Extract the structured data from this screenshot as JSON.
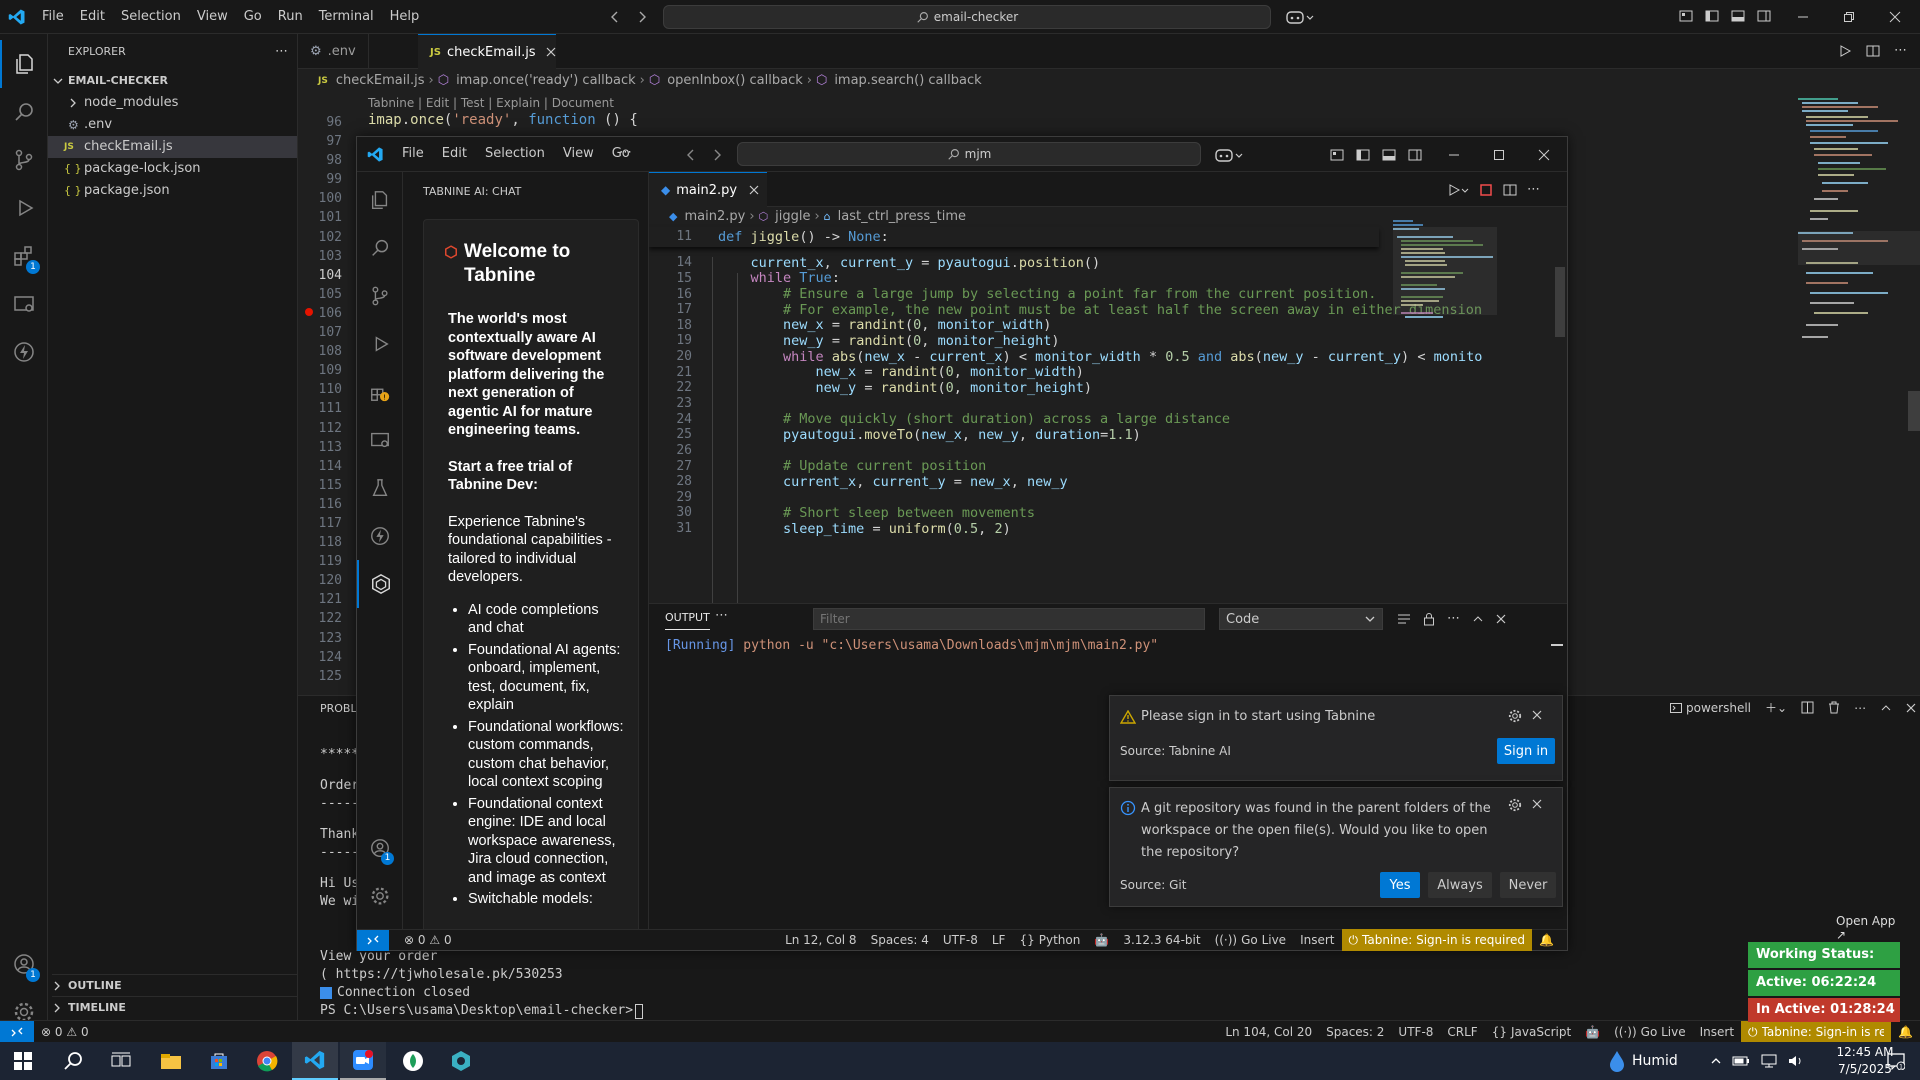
{
  "outer": {
    "menu": [
      "File",
      "Edit",
      "Selection",
      "View",
      "Go",
      "Run",
      "Terminal",
      "Help"
    ],
    "search_text": "email-checker",
    "explorer": {
      "title": "EXPLORER",
      "root": "EMAIL-CHECKER",
      "items": [
        {
          "label": "node_modules",
          "icon": "chevron-right"
        },
        {
          "label": ".env",
          "icon": "gear"
        },
        {
          "label": "checkEmail.js",
          "icon": "JS"
        },
        {
          "label": "package-lock.json",
          "icon": "{ }"
        },
        {
          "label": "package.json",
          "icon": "{ }"
        }
      ],
      "outline": "OUTLINE",
      "timeline": "TIMELINE"
    },
    "tabs": [
      {
        "label": ".env",
        "icon": "⚙"
      },
      {
        "label": "checkEmail.js",
        "icon": "JS"
      }
    ],
    "breadcrumb": [
      "checkEmail.js",
      "imap.once('ready') callback",
      "openInbox() callback",
      "imap.search() callback"
    ],
    "codelens": "Tabnine | Edit | Test | Explain | Document",
    "code_line_96": "imap.once('ready', function () {",
    "line_numbers": [
      "96",
      "97",
      "98",
      "99",
      "100",
      "101",
      "102",
      "103",
      "104",
      "105",
      "106",
      "107",
      "108",
      "109",
      "110",
      "111",
      "112",
      "113",
      "114",
      "115",
      "116",
      "117",
      "118",
      "119",
      "120",
      "121",
      "122",
      "123",
      "124",
      "125"
    ],
    "panel_label": "PROBLI",
    "terminal_peek": [
      "*****",
      "Order",
      "-----",
      "Thank",
      "-----",
      "Hi Us",
      "We wi"
    ],
    "terminal_lines": [
      "View your order",
      "( https://tjwholesale.pk/530253",
      "Connection closed",
      "PS C:\\Users\\usama\\Desktop\\email-checker> "
    ],
    "terminal_shell": "powershell",
    "status": {
      "errors": "0",
      "warnings": "0",
      "cursor": "Ln 104, Col 20",
      "spaces": "Spaces: 2",
      "encoding": "UTF-8",
      "eol": "CRLF",
      "language": "JavaScript",
      "golive": "Go Live",
      "insert": "Insert",
      "tabnine": "Tabnine: Sign-in is required"
    }
  },
  "inner": {
    "menu": [
      "File",
      "Edit",
      "Selection",
      "View",
      "Go"
    ],
    "search_text": "mjm",
    "chat": {
      "title": "TABNINE AI: CHAT",
      "welcome": "Welcome to Tabnine",
      "intro": "The world's most contextually aware AI software development platform delivering the next generation of agentic AI for mature engineering teams.",
      "trial": "Start a free trial of Tabnine Dev:",
      "experience": "Experience Tabnine's foundational capabilities - tailored to individual developers.",
      "features": [
        "AI code completions and chat",
        "Foundational AI agents: onboard, implement, test, document, fix, explain",
        "Foundational workflows: custom commands, custom chat behavior, local context scoping",
        "Foundational context engine: IDE and local workspace awareness, Jira cloud connection, and image as context",
        "Switchable models:"
      ]
    },
    "tab": "main2.py",
    "breadcrumb": [
      "main2.py",
      "jiggle",
      "last_ctrl_press_time"
    ],
    "code_sticky": "def jiggle() -> None:",
    "code_lines": [
      {
        "n": "14",
        "t": "    current_x, current_y = pyautogui.position()"
      },
      {
        "n": "15",
        "t": "    while True:"
      },
      {
        "n": "16",
        "t": "        # Ensure a large jump by selecting a point far from the current position."
      },
      {
        "n": "17",
        "t": "        # For example, the new point must be at least half the screen away in either dimension"
      },
      {
        "n": "18",
        "t": "        new_x = randint(0, monitor_width)"
      },
      {
        "n": "19",
        "t": "        new_y = randint(0, monitor_height)"
      },
      {
        "n": "20",
        "t": "        while abs(new_x - current_x) < monitor_width * 0.5 and abs(new_y - current_y) < monito"
      },
      {
        "n": "21",
        "t": "            new_x = randint(0, monitor_width)"
      },
      {
        "n": "22",
        "t": "            new_y = randint(0, monitor_height)"
      },
      {
        "n": "23",
        "t": ""
      },
      {
        "n": "24",
        "t": "        # Move quickly (short duration) across a large distance"
      },
      {
        "n": "25",
        "t": "        pyautogui.moveTo(new_x, new_y, duration=1.1)"
      },
      {
        "n": "26",
        "t": ""
      },
      {
        "n": "27",
        "t": "        # Update current position"
      },
      {
        "n": "28",
        "t": "        current_x, current_y = new_x, new_y"
      },
      {
        "n": "29",
        "t": ""
      },
      {
        "n": "30",
        "t": "        # Short sleep between movements"
      },
      {
        "n": "31",
        "t": "        sleep_time = uniform(0.5, 2)"
      }
    ],
    "sticky_line_no": "11",
    "output": {
      "title": "OUTPUT",
      "filter_placeholder": "Filter",
      "channel": "Code",
      "running": "[Running] python -u \"c:\\Users\\usama\\Downloads\\mjm\\mjm\\main2.py\""
    },
    "notif1": {
      "message": "Please sign in to start using Tabnine",
      "source": "Source: Tabnine AI",
      "button": "Sign in"
    },
    "notif2": {
      "message": "A git repository was found in the parent folders of the workspace or the open file(s). Would you like to open the repository?",
      "source": "Source: Git",
      "buttons": [
        "Yes",
        "Always",
        "Never"
      ]
    },
    "status": {
      "errors": "0",
      "warnings": "0",
      "cursor": "Ln 12, Col 8",
      "spaces": "Spaces: 4",
      "encoding": "UTF-8",
      "eol": "LF",
      "language": "Python",
      "interpreter": "3.12.3 64-bit",
      "golive": "Go Live",
      "insert": "Insert",
      "tabnine": "Tabnine: Sign-in is required"
    }
  },
  "widget": {
    "open_app": "Open App ↗",
    "working": "Working Status: Active",
    "active": "Active: 06:22:24",
    "inactive": "In Active: 01:28:24"
  },
  "taskbar": {
    "weather": "Humid",
    "time": "12:45 AM",
    "date": "7/5/2025"
  },
  "colors": {
    "accent": "#0078d4",
    "tabnine_status": "#b08a00",
    "green": "#2ea043",
    "red": "#c0392b"
  }
}
